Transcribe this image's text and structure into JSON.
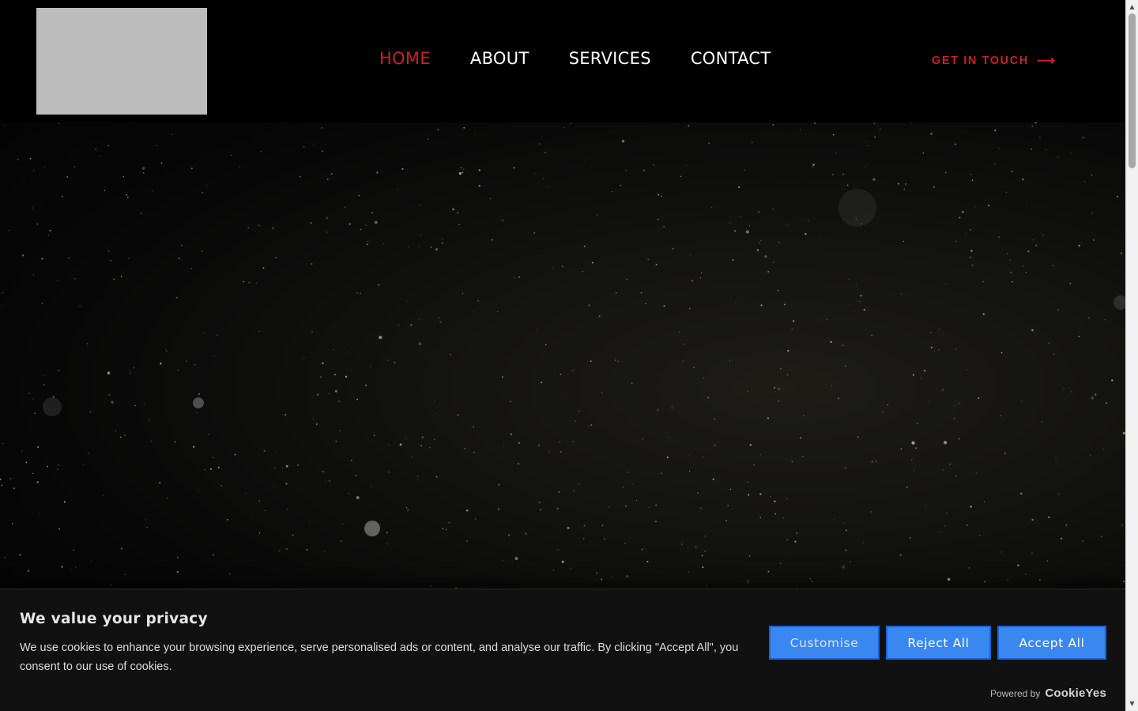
{
  "header": {
    "logo_alt": "",
    "nav": [
      {
        "label": "HOME",
        "active": true
      },
      {
        "label": "ABOUT",
        "active": false
      },
      {
        "label": "SERVICES",
        "active": false
      },
      {
        "label": "CONTACT",
        "active": false
      }
    ],
    "cta_label": "GET IN TOUCH",
    "cta_arrow": "⟶"
  },
  "colors": {
    "accent_red": "#c8212a",
    "button_blue": "#3a87f0",
    "button_border": "#1863dc",
    "banner_bg": "#111111"
  },
  "cookie_banner": {
    "title": "We value your privacy",
    "text": "We use cookies to enhance your browsing experience, serve personalised ads or content, and analyse our traffic. By clicking \"Accept All\", you consent to our use of cookies.",
    "buttons": {
      "customise": "Customise",
      "reject": "Reject All",
      "accept": "Accept All"
    },
    "powered_by": "Powered by",
    "brand": "CookieYes"
  },
  "icons": {
    "cta_arrow": "arrow-right-icon",
    "scroll_up": "triangle-up-icon",
    "scroll_down": "triangle-down-icon"
  }
}
